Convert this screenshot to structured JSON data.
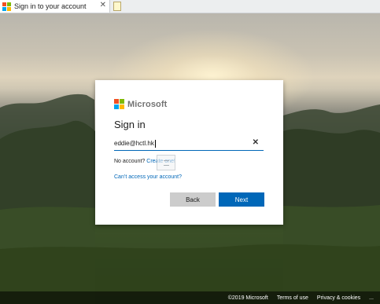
{
  "browser": {
    "tab_title": "Sign in to your account",
    "tab_close": "✕"
  },
  "brand": {
    "name": "Microsoft",
    "logo_colors": [
      "#f25022",
      "#7fba00",
      "#00a4ef",
      "#ffb900"
    ]
  },
  "signin": {
    "heading": "Sign in",
    "email_value": "eddie@hctl.hk",
    "clear_icon": "✕",
    "no_account_text": "No account?",
    "create_link": "Create one!",
    "cant_access_link": "Can’t access your account?",
    "back_label": "Back",
    "next_label": "Next"
  },
  "footer": {
    "copyright": "©2019 Microsoft",
    "terms": "Terms of use",
    "privacy": "Privacy & cookies",
    "more": "..."
  },
  "colors": {
    "accent": "#0067b8",
    "back_button": "#cccccc"
  }
}
